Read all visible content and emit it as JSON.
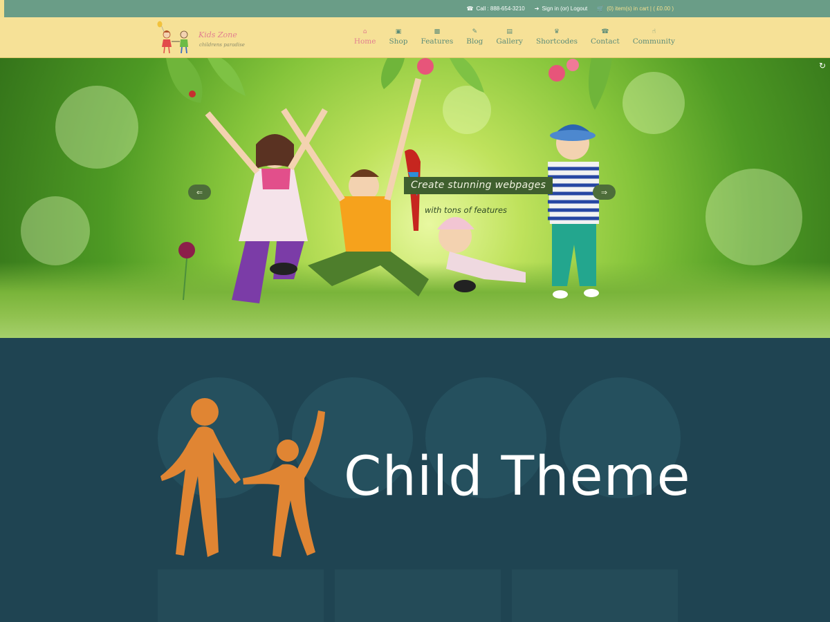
{
  "topbar": {
    "phone": "Call : 888-654-3210",
    "signin": "Sign in (or) Logout",
    "cart": "(0) item(s) in cart  |  ( £0.00 )"
  },
  "logo": {
    "title": "Kids Zone",
    "subtitle": "childrens paradise"
  },
  "nav": {
    "items": [
      {
        "label": "Home",
        "icon": "home-icon",
        "active": true
      },
      {
        "label": "Shop",
        "icon": "cart-icon"
      },
      {
        "label": "Features",
        "icon": "gift-icon"
      },
      {
        "label": "Blog",
        "icon": "pencil-icon"
      },
      {
        "label": "Gallery",
        "icon": "image-icon"
      },
      {
        "label": "Shortcodes",
        "icon": "trophy-icon"
      },
      {
        "label": "Contact",
        "icon": "phone-icon"
      },
      {
        "label": "Community",
        "icon": "thumbs-up-icon"
      }
    ]
  },
  "hero": {
    "caption": "Create stunning webpages",
    "subcaption": "with tons of features"
  },
  "overlay": {
    "title": "Child Theme"
  },
  "colors": {
    "topbar": "#6a9d87",
    "header": "#f6e197",
    "accent": "#e2808f",
    "nav": "#5c8c78",
    "lower_bg": "#1f4452",
    "figure": "#e08533"
  }
}
